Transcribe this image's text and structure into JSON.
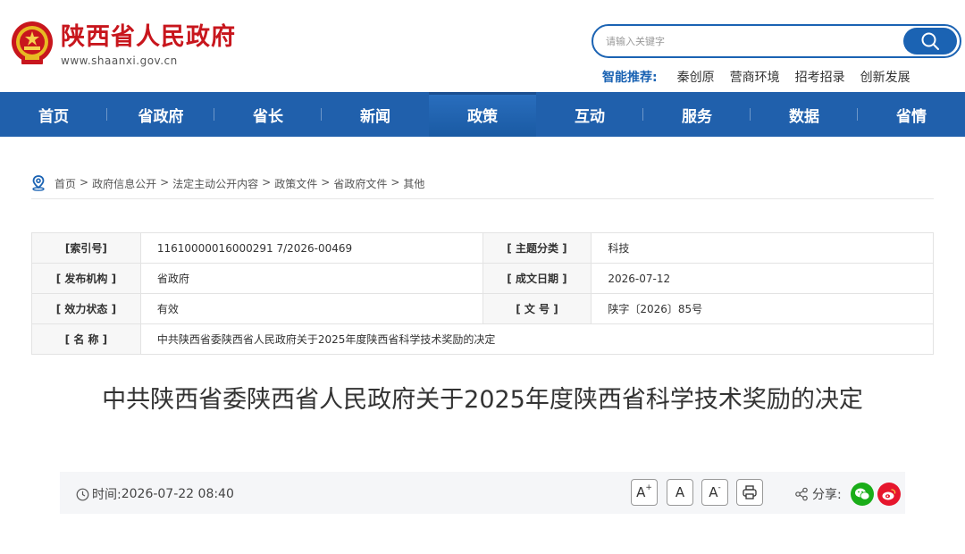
{
  "header": {
    "site_name": "陕西省人民政府",
    "site_url": "www.shaanxi.gov.cn",
    "search_placeholder": "请输入关键字",
    "hot_label": "智能推荐:",
    "hot_items": [
      "秦创原",
      "营商环境",
      "招考招录",
      "创新发展"
    ]
  },
  "nav": {
    "items": [
      "首页",
      "省政府",
      "省长",
      "新闻",
      "政策",
      "互动",
      "服务",
      "数据",
      "省情"
    ],
    "active": "政策"
  },
  "breadcrumb": [
    "首页",
    "政府信息公开",
    "法定主动公开内容",
    "政策文件",
    "省政府文件",
    "其他"
  ],
  "breadcrumb_sep": ">",
  "info": {
    "index_label": "[索引号]",
    "index_value": "11610000016000291 7/2026-00469",
    "topic_label": "[ 主题分类 ]",
    "topic_value": "科技",
    "issuer_label": "[ 发布机构 ]",
    "issuer_value": "省政府",
    "date_label": "[ 成文日期 ]",
    "date_value": "2026-07-12",
    "status_label": "[ 效力状态 ]",
    "status_value": "有效",
    "docno_label": "[ 文 号 ]",
    "docno_value": "陕字〔2026〕85号",
    "name_label": "[ 名 称 ]",
    "name_value": "中共陕西省委陕西省人民政府关于2025年度陕西省科学技术奖励的决定"
  },
  "article": {
    "title": "中共陕西省委陕西省人民政府关于2025年度陕西省科学技术奖励的决定",
    "time_label": "时间:",
    "time_value": "2026-07-22 08:40",
    "font_large": "A",
    "font_large_sup": "+",
    "font_normal": "A",
    "font_small": "A",
    "font_small_sup": "-",
    "share_label": "分享:"
  },
  "colors": {
    "brand_red": "#c8161d",
    "nav_blue": "#2060ac",
    "wechat_green": "#1aad19",
    "weibo_red": "#e6162d"
  },
  "icons": [
    "emblem-icon",
    "search-icon",
    "location-icon",
    "clock-icon",
    "print-icon",
    "share-icon",
    "wechat-icon",
    "weibo-icon"
  ]
}
